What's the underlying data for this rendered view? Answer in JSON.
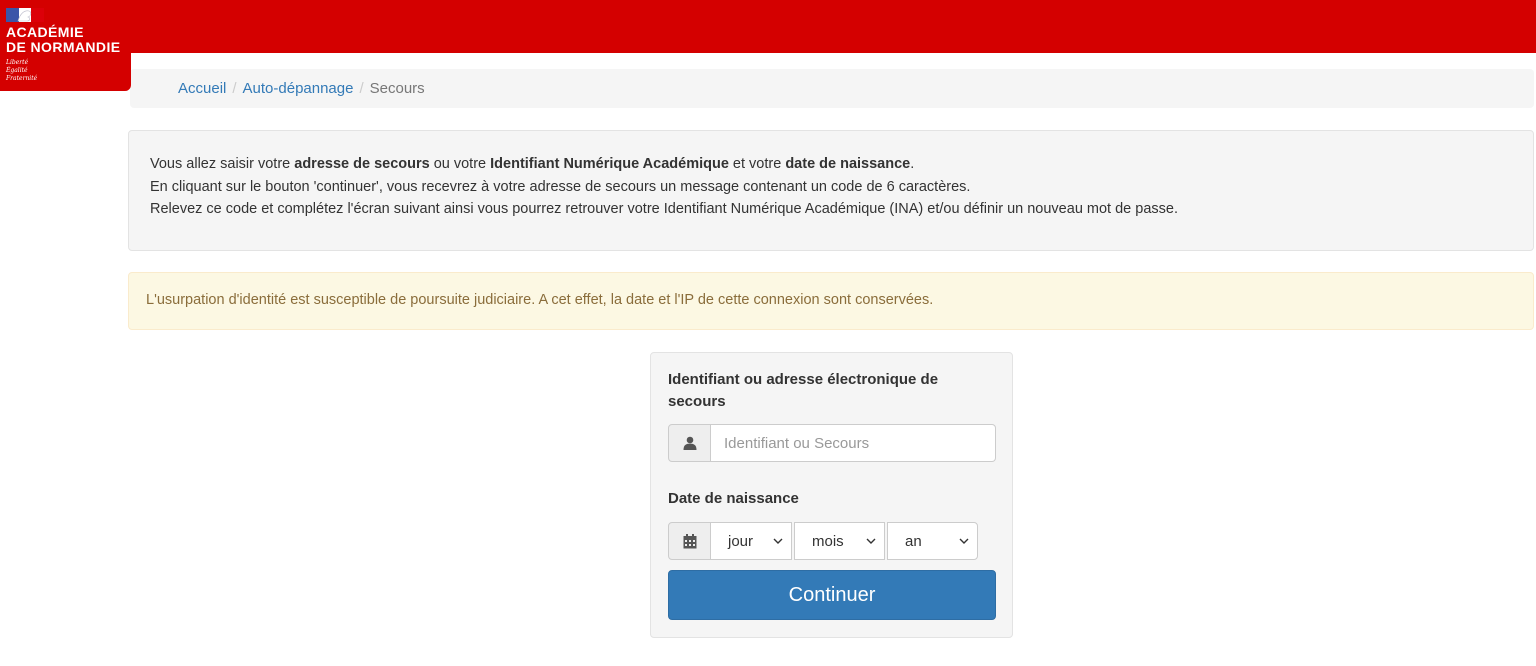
{
  "colors": {
    "brand_red": "#d40000",
    "link": "#337ab7",
    "primary_button": "#337ab7",
    "warning_bg": "#fcf8e3",
    "warning_text": "#8a6d3b"
  },
  "logo": {
    "line1": "ACADÉMIE",
    "line2": "DE NORMANDIE",
    "motto": [
      "Liberté",
      "Égalité",
      "Fraternité"
    ],
    "icon": "marianne-flag-icon"
  },
  "breadcrumb": {
    "items": [
      {
        "label": "Accueil"
      },
      {
        "label": "Auto-dépannage"
      },
      {
        "label": "Secours"
      }
    ],
    "separator": "/"
  },
  "info": {
    "line1": {
      "t1": "Vous allez saisir votre ",
      "b1": "adresse de secours",
      "t2": " ou votre ",
      "b2": "Identifiant Numérique Académique",
      "t3": " et votre ",
      "b3": "date de naissance",
      "t4": "."
    },
    "line2": "En cliquant sur le bouton 'continuer', vous recevrez à votre adresse de secours un message contenant un code de 6 caractères.",
    "line3": "Relevez ce code et complétez l'écran suivant ainsi vous pourrez retrouver votre Identifiant Numérique Académique (INA) et/ou définir un nouveau mot de passe."
  },
  "warning": "L'usurpation d'identité est susceptible de poursuite judiciaire. A cet effet, la date et l'IP de cette connexion sont conservées.",
  "form": {
    "identifier_label": "Identifiant ou adresse électronique de secours",
    "identifier_icon": "user-icon",
    "identifier_placeholder": "Identifiant ou Secours",
    "identifier_value": "",
    "dob_label": "Date de naissance",
    "dob_icon": "calendar-icon",
    "day_selected": "jour",
    "month_selected": "mois",
    "year_selected": "an",
    "submit_label": "Continuer"
  }
}
